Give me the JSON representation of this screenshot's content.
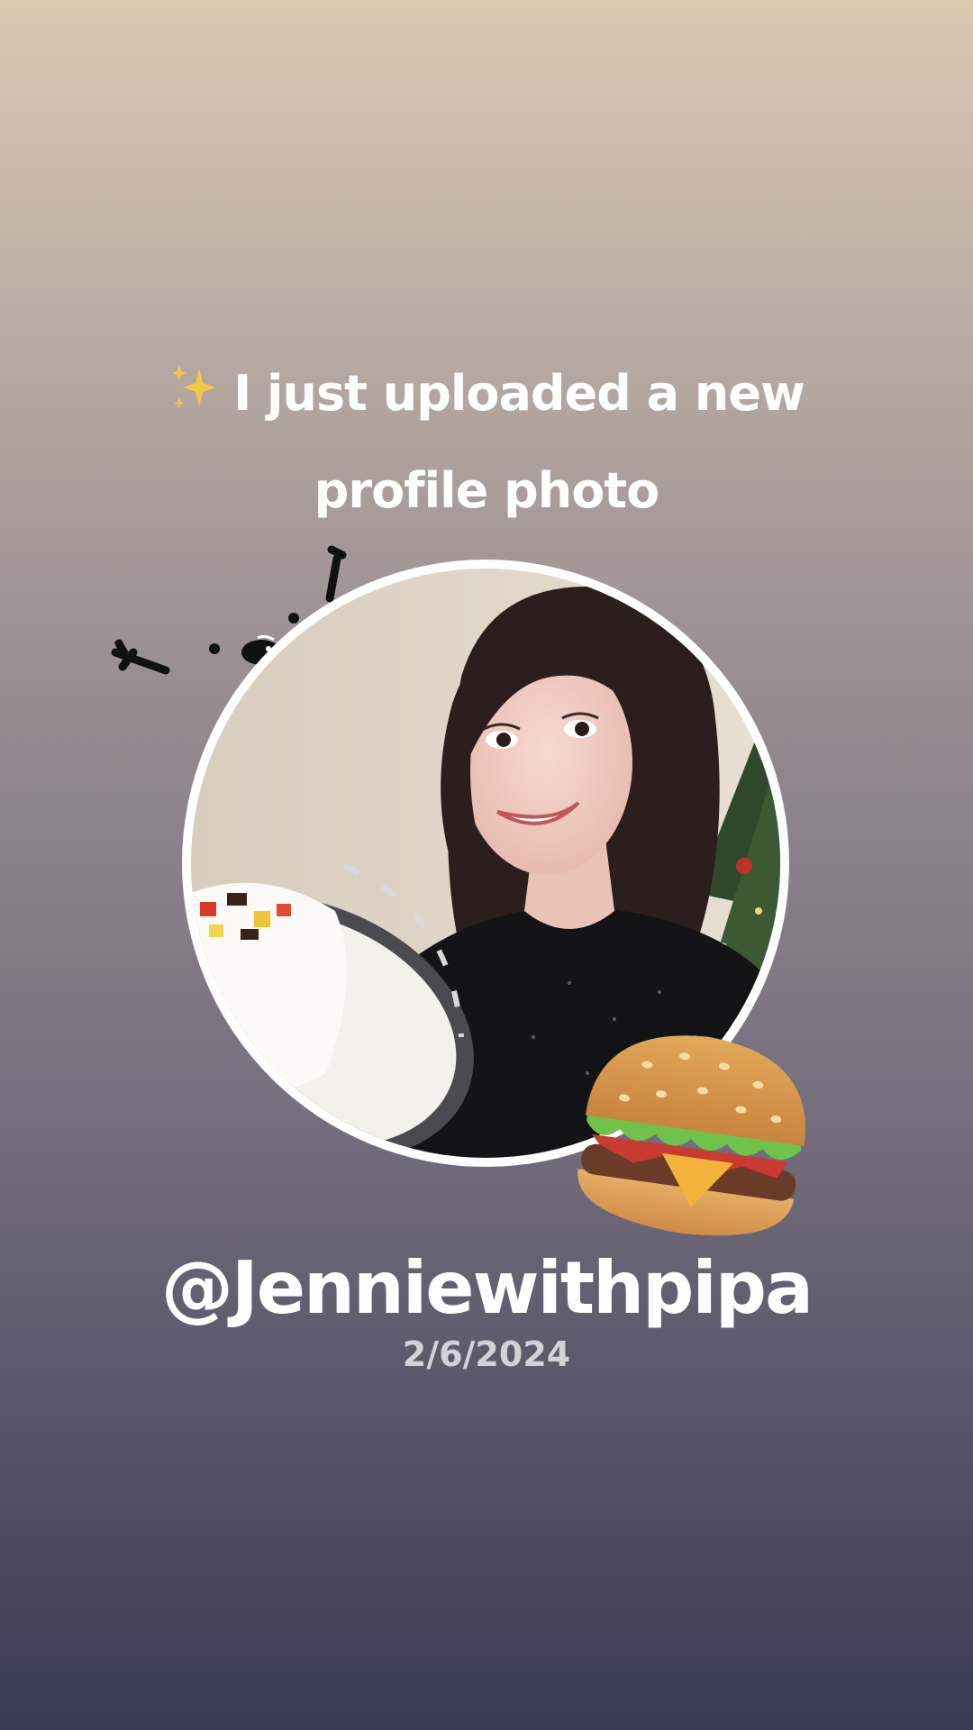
{
  "headline": {
    "sparkle_icon": "sparkles-icon",
    "line1": "I just uploaded a new",
    "line2": "profile photo"
  },
  "profile": {
    "photo_icon": "profile-photo",
    "username": "@Jenniewithpipa",
    "date": "2/6/2024"
  },
  "stickers": {
    "doodle": "doodle-sticker",
    "burger": "hamburger-emoji"
  },
  "colors": {
    "background_top": "#dac8b2",
    "background_bottom": "#393a55",
    "text": "#ffffff",
    "date_text": "#d4d1d8",
    "sparkle": "#f5c842"
  }
}
